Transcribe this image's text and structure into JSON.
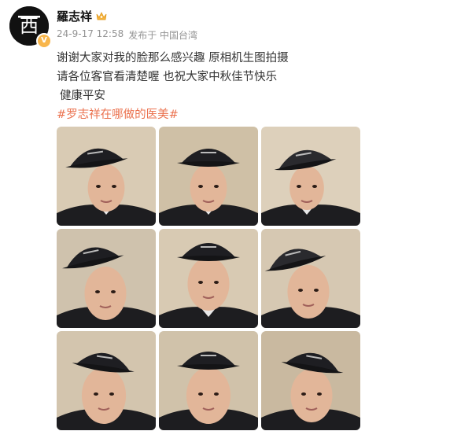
{
  "user": {
    "name": "羅志祥",
    "avatar_text": "西",
    "verified_badge": "V"
  },
  "meta": {
    "timestamp": "24-9-17 12:58",
    "source": "发布于 中国台湾"
  },
  "post": {
    "lines": [
      "谢谢大家对我的脸那么感兴趣 原相机生图拍摄",
      "请各位客官看清楚喔 也祝大家中秋佳节快乐",
      "健康平安"
    ],
    "hashtag": "#罗志祥在哪做的医美#"
  },
  "photos": [
    {
      "bg": "#d9cbb4",
      "cap": "#1e1e22"
    },
    {
      "bg": "#cfc0a6",
      "cap": "#1e1e22"
    },
    {
      "bg": "#ddd0bb",
      "cap": "#2a2a2e"
    },
    {
      "bg": "#cfc2ad",
      "cap": "#1e1e22"
    },
    {
      "bg": "#d8cab3",
      "cap": "#1e1e22"
    },
    {
      "bg": "#d6c8b2",
      "cap": "#2a2a2e"
    },
    {
      "bg": "#d3c5ae",
      "cap": "#1e1e22"
    },
    {
      "bg": "#d0c2aa",
      "cap": "#1e1e22"
    },
    {
      "bg": "#c9b9a0",
      "cap": "#1e1e22"
    }
  ],
  "colors": {
    "hashtag": "#eb7350",
    "meta": "#939393",
    "badge": "#f8b64c"
  }
}
